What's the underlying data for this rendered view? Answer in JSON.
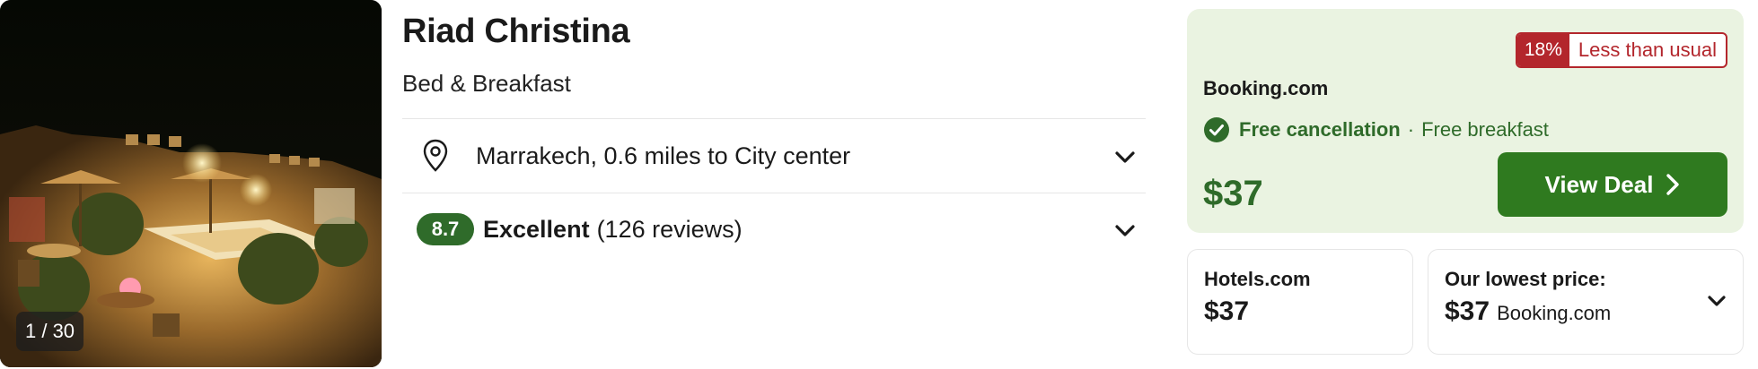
{
  "photo": {
    "counter": "1 / 30",
    "description_icon": "hotel-rooftop-photo"
  },
  "hotel": {
    "name": "Riad Christina",
    "type": "Bed & Breakfast"
  },
  "location": {
    "icon": "location-pin-icon",
    "text": "Marrakech, 0.6 miles to City center"
  },
  "rating": {
    "score": "8.7",
    "label": "Excellent",
    "reviews": "(126 reviews)"
  },
  "deal": {
    "discount_pct": "18%",
    "discount_text": "Less than usual",
    "provider": "Booking.com",
    "free_cancellation": "Free cancellation",
    "separator": "·",
    "free_breakfast": "Free breakfast",
    "price": "$37",
    "cta_label": "View Deal"
  },
  "other_offers": [
    {
      "provider": "Hotels.com",
      "price": "$37"
    }
  ],
  "lowest": {
    "title": "Our lowest price:",
    "price": "$37",
    "provider": "Booking.com"
  },
  "colors": {
    "green_dark": "#2f6b2a",
    "green_button": "#2f7a1f",
    "deal_bg": "#eaf3e1",
    "badge_red": "#b3262c"
  }
}
